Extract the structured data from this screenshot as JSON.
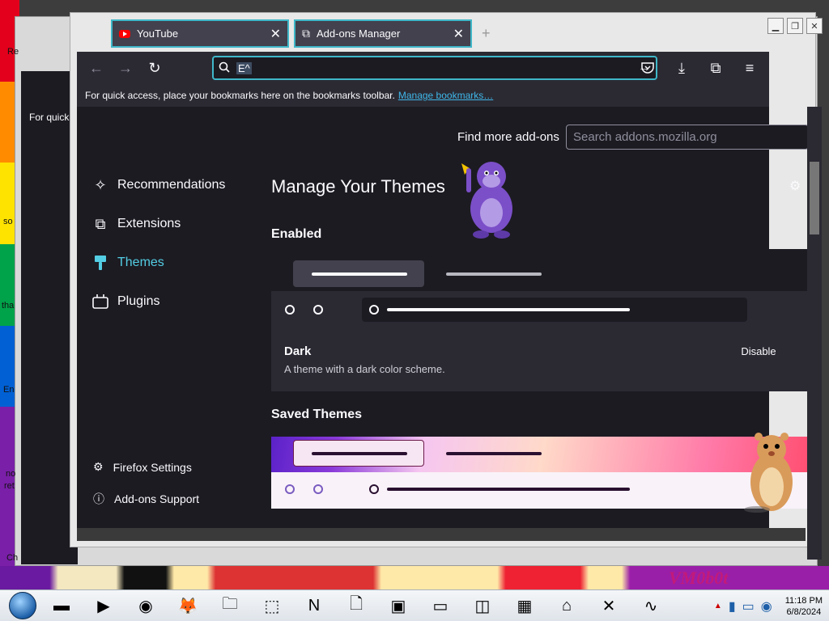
{
  "tabs": [
    {
      "label": "YouTube"
    },
    {
      "label": "Add-ons Manager"
    }
  ],
  "urlbar": {
    "value": "E^"
  },
  "bookmarks_bar": {
    "text": "For quick access, place your bookmarks here on the bookmarks toolbar.",
    "link": "Manage bookmarks…"
  },
  "ghost": {
    "for_quick": "For quick",
    "left_labels": [
      "Re",
      "so",
      "tha",
      "En",
      "no",
      "ret",
      "Ch"
    ]
  },
  "sidebar": {
    "items": [
      {
        "label": "Recommendations"
      },
      {
        "label": "Extensions"
      },
      {
        "label": "Themes"
      },
      {
        "label": "Plugins"
      }
    ],
    "footer": [
      {
        "label": "Firefox Settings"
      },
      {
        "label": "Add-ons Support"
      }
    ]
  },
  "main": {
    "find_more": "Find more add-ons",
    "search_placeholder": "Search addons.mozilla.org",
    "title": "Manage Your Themes",
    "enabled_heading": "Enabled",
    "saved_heading": "Saved Themes",
    "enabled_theme": {
      "name": "Dark",
      "description": "A theme with a dark color scheme.",
      "action": "Disable"
    }
  },
  "desktop": {
    "vm_text": "VM0b0t"
  },
  "taskbar": {
    "time": "11:18 PM",
    "date": "6/8/2024"
  },
  "colors": {
    "accent": "#53cde3",
    "tab_border": "#3fb7c9",
    "bg_dark": "#1c1b22",
    "panel": "#2b2a33"
  }
}
